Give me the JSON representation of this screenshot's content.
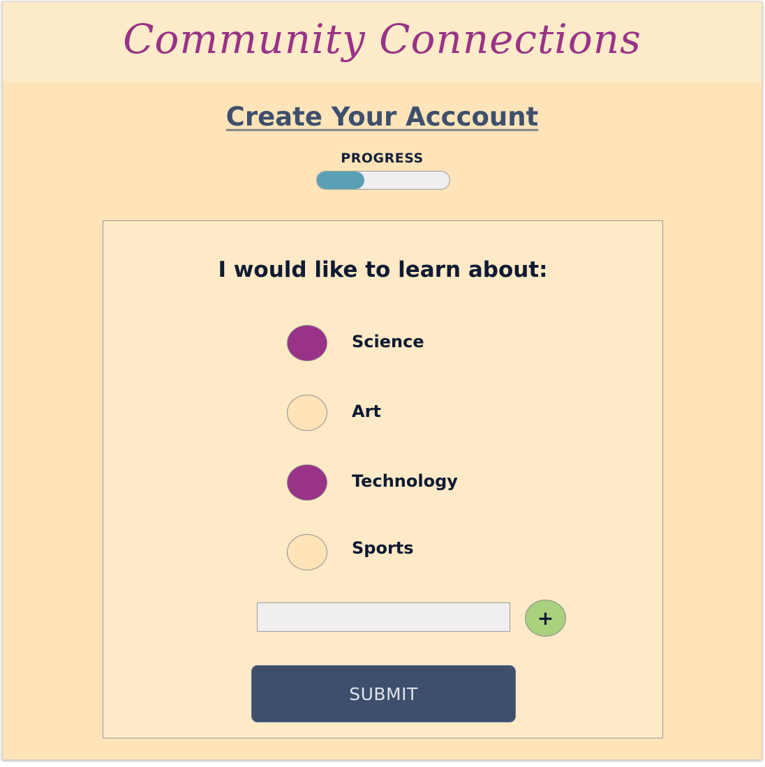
{
  "header": {
    "app_title": "Community Connections"
  },
  "main": {
    "page_title": "Create Your Acccount",
    "progress": {
      "label": "PROGRESS",
      "value_fraction": 0.36,
      "fill_color": "#5aa0b4"
    },
    "card": {
      "prompt": "I would like to learn about:",
      "options": [
        {
          "label": "Science",
          "selected": true
        },
        {
          "label": "Art",
          "selected": false
        },
        {
          "label": "Technology",
          "selected": true
        },
        {
          "label": "Sports",
          "selected": false
        }
      ],
      "add_input": {
        "value": "",
        "placeholder": ""
      },
      "add_button_label": "+",
      "submit_label": "SUBMIT"
    }
  },
  "colors": {
    "accent_purple": "#983387",
    "page_background": "#fee4b8",
    "header_background": "#feebc9",
    "submit_button": "#3d4f6d",
    "add_button": "#a9d17e"
  }
}
